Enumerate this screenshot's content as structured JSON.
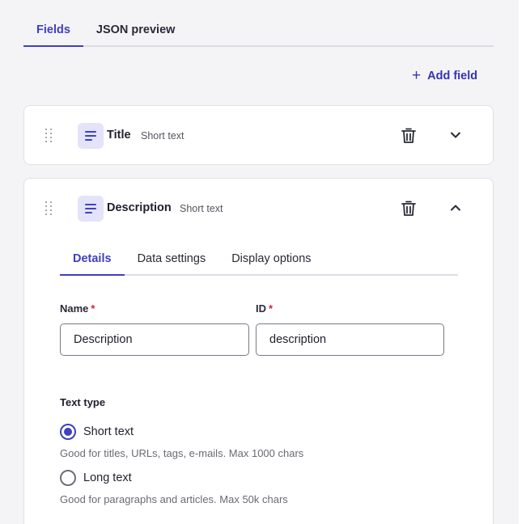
{
  "top_tabs": [
    {
      "label": "Fields",
      "active": true
    },
    {
      "label": "JSON preview",
      "active": false
    }
  ],
  "add_field": {
    "icon": "plus-icon",
    "label": "Add field"
  },
  "fields": [
    {
      "name": "Title",
      "type": "Short text",
      "icon": "short-text-icon",
      "expanded": false
    },
    {
      "name": "Description",
      "type": "Short text",
      "icon": "short-text-icon",
      "expanded": true
    }
  ],
  "detail_tabs": [
    {
      "label": "Details",
      "active": true
    },
    {
      "label": "Data settings",
      "active": false
    },
    {
      "label": "Display options",
      "active": false
    }
  ],
  "form": {
    "name_label": "Name",
    "name_value": "Description",
    "id_label": "ID",
    "id_value": "description",
    "required_mark": "*"
  },
  "text_type": {
    "title": "Text type",
    "options": [
      {
        "label": "Short text",
        "help": "Good for titles, URLs, tags, e-mails. Max 1000 chars",
        "selected": true
      },
      {
        "label": "Long text",
        "help": "Good for paragraphs and articles. Max 50k chars",
        "selected": false
      }
    ]
  },
  "colors": {
    "accent": "#3f3fbf",
    "required": "#d81e3a",
    "icon_bg": "#e3e3fa"
  }
}
